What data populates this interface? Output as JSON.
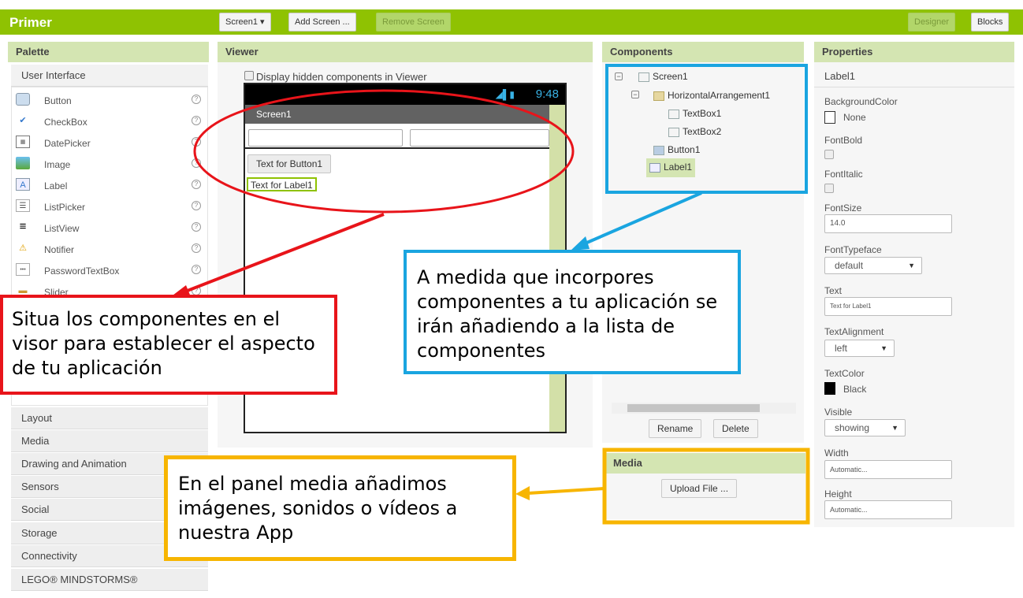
{
  "app": {
    "title": "Primer",
    "screen_select": "Screen1 ▾",
    "add_screen": "Add Screen ...",
    "remove_screen": "Remove Screen",
    "designer": "Designer",
    "blocks": "Blocks"
  },
  "palette": {
    "header": "Palette",
    "open_category": "User Interface",
    "items": [
      {
        "label": "Button",
        "icon": "button-icon"
      },
      {
        "label": "CheckBox",
        "icon": "checkbox-icon"
      },
      {
        "label": "DatePicker",
        "icon": "datepicker-icon"
      },
      {
        "label": "Image",
        "icon": "image-icon"
      },
      {
        "label": "Label",
        "icon": "label-icon"
      },
      {
        "label": "ListPicker",
        "icon": "listpicker-icon"
      },
      {
        "label": "ListView",
        "icon": "listview-icon"
      },
      {
        "label": "Notifier",
        "icon": "notifier-icon"
      },
      {
        "label": "PasswordTextBox",
        "icon": "passwordtextbox-icon"
      },
      {
        "label": "Slider",
        "icon": "slider-icon"
      }
    ],
    "help_glyph": "?",
    "categories": [
      "Layout",
      "Media",
      "Drawing and Animation",
      "Sensors",
      "Social",
      "Storage",
      "Connectivity",
      "LEGO® MINDSTORMS®"
    ]
  },
  "viewer": {
    "header": "Viewer",
    "hidden_label": "Display hidden components in Viewer",
    "time": "9:48",
    "screen_title": "Screen1",
    "button_text": "Text for Button1",
    "label_text": "Text for Label1"
  },
  "components": {
    "header": "Components",
    "tree": {
      "screen": "Screen1",
      "arrangement": "HorizontalArrangement1",
      "textbox1": "TextBox1",
      "textbox2": "TextBox2",
      "button": "Button1",
      "label": "Label1"
    },
    "rename": "Rename",
    "delete": "Delete"
  },
  "media": {
    "header": "Media",
    "upload": "Upload File ..."
  },
  "properties": {
    "header": "Properties",
    "component": "Label1",
    "background_color_label": "BackgroundColor",
    "background_color_value": "None",
    "font_bold_label": "FontBold",
    "font_italic_label": "FontItalic",
    "font_size_label": "FontSize",
    "font_size_value": "14.0",
    "font_typeface_label": "FontTypeface",
    "font_typeface_value": "default",
    "text_label": "Text",
    "text_value": "Text for Label1",
    "text_alignment_label": "TextAlignment",
    "text_alignment_value": "left",
    "text_color_label": "TextColor",
    "text_color_value": "Black",
    "visible_label": "Visible",
    "visible_value": "showing",
    "width_label": "Width",
    "width_value": "Automatic...",
    "height_label": "Height",
    "height_value": "Automatic..."
  },
  "callouts": {
    "red": "Situa los componentes en el visor para establecer el aspecto de tu aplicación",
    "blue": "A medida que incorpores componentes a tu aplicación se irán añadiendo a la lista de componentes",
    "yellow": "En el panel media añadimos imágenes, sonidos o vídeos a nuestra App"
  },
  "colors": {
    "brand_green": "#8fc202",
    "panel_header": "#d4e5b2",
    "callout_red": "#e8141a",
    "callout_blue": "#1aa5e0",
    "callout_yellow": "#f7b500"
  }
}
